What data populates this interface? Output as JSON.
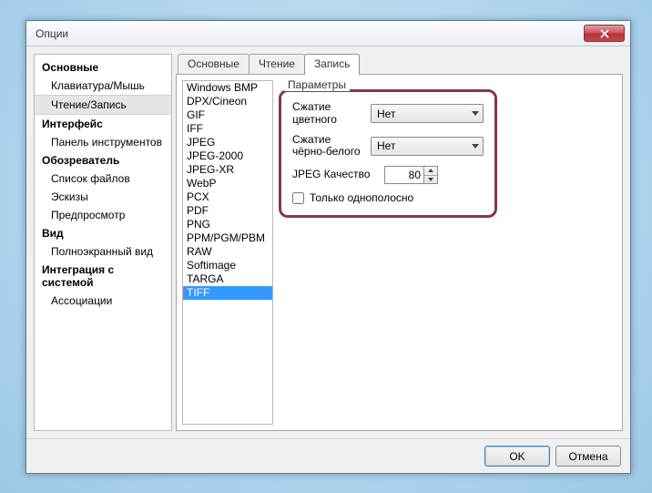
{
  "window": {
    "title": "Опции"
  },
  "sidebar": {
    "groups": [
      {
        "head": "Основные",
        "items": [
          "Клавиатура/Мышь",
          "Чтение/Запись"
        ],
        "selected": 1
      },
      {
        "head": "Интерфейс",
        "items": [
          "Панель инструментов"
        ]
      },
      {
        "head": "Обозреватель",
        "items": [
          "Список файлов",
          "Эскизы",
          "Предпросмотр"
        ]
      },
      {
        "head": "Вид",
        "items": [
          "Полноэкранный вид"
        ]
      },
      {
        "head": "Интеграция с системой",
        "items": [
          "Ассоциации"
        ]
      }
    ]
  },
  "tabs": {
    "items": [
      "Основные",
      "Чтение",
      "Запись"
    ],
    "active": 2
  },
  "formats": {
    "items": [
      "Windows BMP",
      "DPX/Cineon",
      "GIF",
      "IFF",
      "JPEG",
      "JPEG-2000",
      "JPEG-XR",
      "WebP",
      "PCX",
      "PDF",
      "PNG",
      "PPM/PGM/PBM",
      "RAW",
      "Softimage",
      "TARGA",
      "TIFF"
    ],
    "selected": 15
  },
  "params": {
    "legend": "Параметры",
    "color_comp_label": "Сжатие цветного",
    "color_comp_value": "Нет",
    "bw_comp_label": "Сжатие чёрно-белого",
    "bw_comp_value": "Нет",
    "jpeg_q_label": "JPEG Качество",
    "jpeg_q_value": "80",
    "single_strip_label": "Только однополосно"
  },
  "buttons": {
    "ok": "OK",
    "cancel": "Отмена"
  }
}
